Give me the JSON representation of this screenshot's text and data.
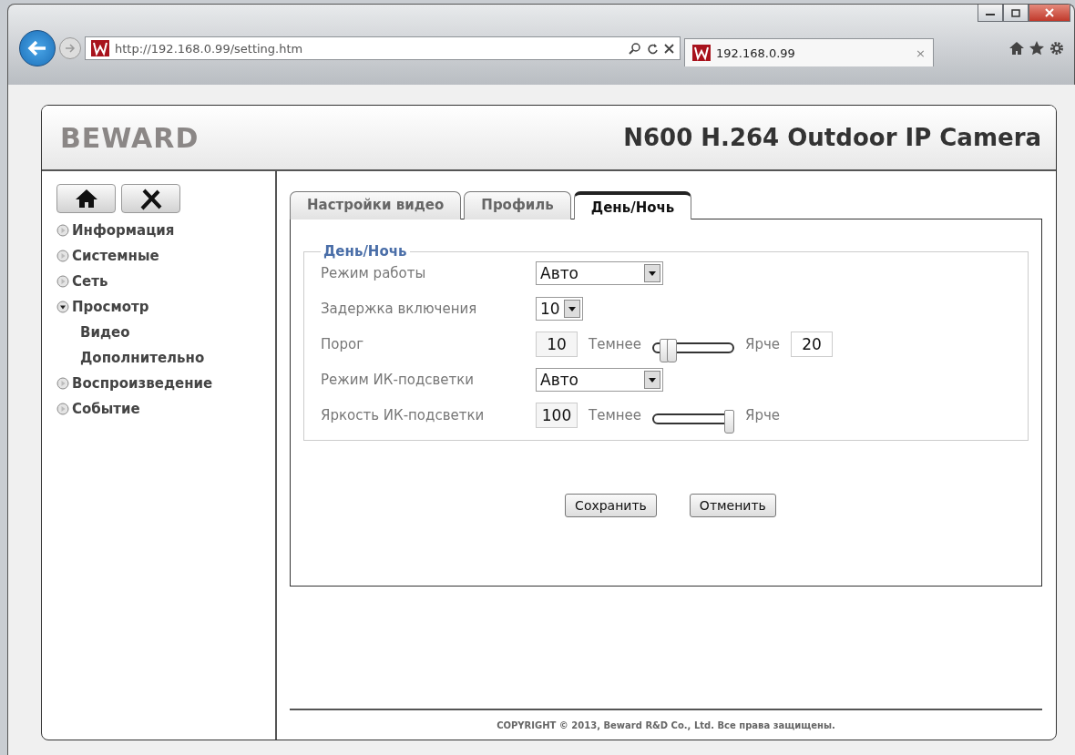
{
  "browser": {
    "url": "http://192.168.0.99/setting.htm",
    "tab": {
      "title": "192.168.0.99",
      "close": "×"
    }
  },
  "header": {
    "logo": "BEWARD",
    "title": "N600 H.264 Outdoor IP Camera"
  },
  "sidebar": {
    "items": [
      {
        "label": "Информация",
        "expanded": false
      },
      {
        "label": "Системные",
        "expanded": false
      },
      {
        "label": "Сеть",
        "expanded": false
      },
      {
        "label": "Просмотр",
        "expanded": true,
        "children": [
          {
            "label": "Видео"
          },
          {
            "label": "Дополнительно"
          }
        ]
      },
      {
        "label": "Воспроизведение",
        "expanded": false
      },
      {
        "label": "Событие",
        "expanded": false
      }
    ]
  },
  "tabs": [
    {
      "label": "Настройки видео",
      "selected": false
    },
    {
      "label": "Профиль",
      "selected": false
    },
    {
      "label": "День/Ночь",
      "selected": true
    }
  ],
  "group": {
    "title": "День/Ночь",
    "fields": [
      {
        "kind": "select",
        "label": "Режим работы",
        "value": "Авто",
        "wide": true
      },
      {
        "kind": "select",
        "label": "Задержка включения",
        "value": "10",
        "wide": false
      },
      {
        "kind": "range",
        "label": "Порог",
        "value": "10",
        "min_label": "Темнее",
        "max_label": "Ярче",
        "thumbs": [
          {
            "level": 0.1
          },
          {
            "level": 0.2
          }
        ],
        "value_high": "20"
      },
      {
        "kind": "select",
        "label": "Режим ИК-подсветки",
        "value": "Авто",
        "wide": true
      },
      {
        "kind": "slider",
        "label": "Яркость ИК-подсветки",
        "value": "100",
        "min_label": "Темнее",
        "max_label": "Ярче",
        "thumbs": [
          {
            "level": 1
          }
        ]
      }
    ]
  },
  "buttons": [
    {
      "label": "Сохранить"
    },
    {
      "label": "Отменить"
    }
  ],
  "footer": "COPYRIGHT © 2013, Beward R&D Co., Ltd. Все права защищены."
}
